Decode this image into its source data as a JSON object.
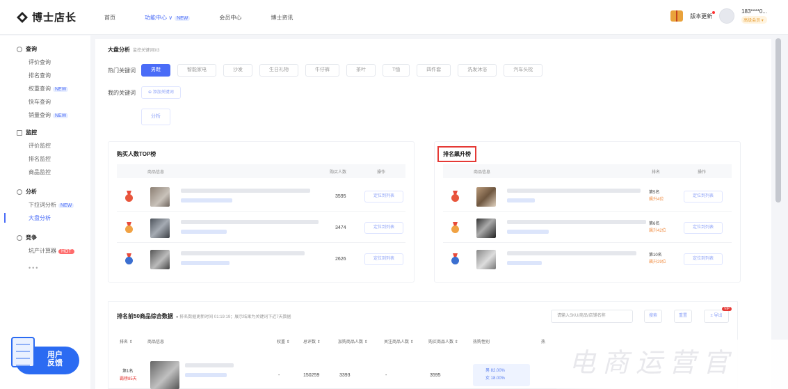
{
  "brand": {
    "name": "博士店长"
  },
  "topnav": [
    {
      "label": "首页",
      "active": false,
      "badge": ""
    },
    {
      "label": "功能中心 ∨",
      "active": true,
      "badge": "NEW"
    },
    {
      "label": "会员中心",
      "active": false,
      "badge": ""
    },
    {
      "label": "博士资讯",
      "active": false,
      "badge": ""
    }
  ],
  "top_right": {
    "version_label": "版本更新",
    "user_phone": "183****0...",
    "user_tag": "高级会员 ▾"
  },
  "sidebar": {
    "groups": [
      {
        "title": "查询",
        "items": [
          {
            "label": "评价查询",
            "badge": ""
          },
          {
            "label": "排名查询",
            "badge": ""
          },
          {
            "label": "权重查询",
            "badge": "NEW"
          },
          {
            "label": "快车查询",
            "badge": ""
          },
          {
            "label": "销量查询",
            "badge": "NEW"
          }
        ]
      },
      {
        "title": "监控",
        "items": [
          {
            "label": "评价监控",
            "badge": ""
          },
          {
            "label": "排名监控",
            "badge": ""
          },
          {
            "label": "商品监控",
            "badge": ""
          }
        ]
      },
      {
        "title": "分析",
        "items": [
          {
            "label": "下拉词分析",
            "badge": "NEW"
          },
          {
            "label": "大盘分析",
            "badge": "",
            "active": true
          }
        ]
      },
      {
        "title": "竞争",
        "items": [
          {
            "label": "坑产计算器",
            "badge": "HOT"
          }
        ]
      }
    ],
    "more": "•••",
    "feedback": {
      "line1": "用户",
      "line2": "反馈"
    }
  },
  "analysis": {
    "title": "大盘分析",
    "subtitle": "监控关键词0/3",
    "hot_label": "热门关键词",
    "hot_keywords": [
      "男鞋",
      "智能家电",
      "沙发",
      "生日礼物",
      "牛仔裤",
      "茶叶",
      "T恤",
      "四件套",
      "洗发沐浴",
      "汽车头枕"
    ],
    "my_label": "我的关键词",
    "add_keyword": "⊕ 添加关键词",
    "analyze_btn": "分析"
  },
  "top_buyers": {
    "title": "购买人数TOP榜",
    "col_info": "商品信息",
    "col_count": "购买人数",
    "col_action": "操作",
    "rows": [
      {
        "count": "3595",
        "action": "定位到列表"
      },
      {
        "count": "3474",
        "action": "定位到列表"
      },
      {
        "count": "2626",
        "action": "定位到列表"
      }
    ]
  },
  "rank_rise": {
    "title": "排名飙升榜",
    "col_info": "商品信息",
    "col_rank": "排名",
    "col_action": "操作",
    "rows": [
      {
        "rank": "第5名",
        "rise": "飙升4位",
        "action": "定位到列表"
      },
      {
        "rank": "第6名",
        "rise": "飙升42位",
        "action": "定位到列表"
      },
      {
        "rank": "第10名",
        "rise": "飙升29位",
        "action": "定位到列表"
      }
    ]
  },
  "top50": {
    "title": "排名前50商品综合数据",
    "note": "● 排名数据更新时间 01:19:19；展示结果为关键词下近7天数据",
    "search_placeholder": "请输入SKU/商品/店铺名称",
    "search_btn": "搜索",
    "reset_btn": "重置",
    "export_btn": "± 导出",
    "vip": "VIP",
    "headers": [
      "排名 ⇕",
      "商品信息",
      "权重 ⇕",
      "总评数 ⇕",
      "加购商品人数 ⇕",
      "关注商品人数 ⇕",
      "购买商品人数 ⇕",
      "热购性别",
      "热"
    ],
    "first_row": {
      "rank": "第1名",
      "rise": "霸榜85天",
      "weight": "-",
      "reviews": "150259",
      "add_cart": "3393",
      "follow": "-",
      "buyers": "3595"
    },
    "gender": {
      "male": "男  82.00%",
      "female": "女  18.00%"
    }
  },
  "watermark": "电商运营官",
  "colors": {
    "accent": "#4a6cf7",
    "highlight_border": "#e53935"
  }
}
